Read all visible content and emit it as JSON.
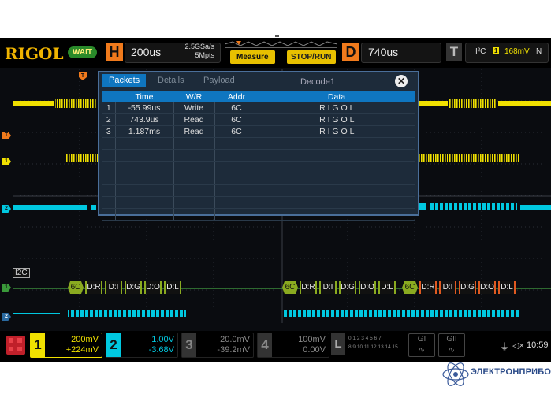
{
  "brand": "RIGOL",
  "run_state": "WAIT",
  "horizontal": {
    "key": "H",
    "timebase": "200us",
    "sample_rate": "2.5GSa/s",
    "memory_depth": "5Mpts"
  },
  "buttons": {
    "measure": "Measure",
    "stop_run": "STOP/RUN"
  },
  "delay": {
    "key": "D",
    "value": "740us"
  },
  "trigger": {
    "key": "T",
    "source": "I²C",
    "channel": "1",
    "level": "168mV",
    "mode": "N"
  },
  "markers": {
    "trigger_pos": "T",
    "ch1": "1",
    "ch2": "2",
    "bus": "I2C"
  },
  "bus_frames": [
    {
      "addr": "6C",
      "bytes": [
        "D:R",
        "D:I",
        "D:G",
        "D:O",
        "D:L"
      ]
    },
    {
      "addr": "6C",
      "bytes": [
        "D:R",
        "D:I",
        "D:G",
        "D:O",
        "D:L"
      ]
    },
    {
      "addr": "6C",
      "bytes": [
        "D:R",
        "D:I",
        "D:G",
        "D:O",
        "D:L"
      ]
    }
  ],
  "dialog": {
    "tabs": [
      "Packets",
      "Details",
      "Payload"
    ],
    "title": "Decode1",
    "columns": [
      "",
      "Time",
      "W/R",
      "Addr",
      "Data"
    ],
    "rows": [
      [
        "1",
        "-55.99us",
        "Write",
        "6C",
        "R I G O L"
      ],
      [
        "2",
        "743.9us",
        "Read",
        "6C",
        "R I G O L"
      ],
      [
        "3",
        "1.187ms",
        "Read",
        "6C",
        "R I G O L"
      ]
    ]
  },
  "channels": [
    {
      "num": "1",
      "scale": "200mV",
      "offset": "+224mV",
      "color": "#f0e000"
    },
    {
      "num": "2",
      "scale": "1.00V",
      "offset": "-3.68V",
      "color": "#00c8e0"
    },
    {
      "num": "3",
      "scale": "20.0mV",
      "offset": "-39.2mV",
      "color": "#777777"
    },
    {
      "num": "4",
      "scale": "100mV",
      "offset": "0.00V",
      "color": "#777777"
    }
  ],
  "logic": {
    "key": "L",
    "row1": "0 1 2 3 4 5 6 7",
    "row2": "8 9 10 11 12 13 14 15"
  },
  "gen_buttons": [
    "GI",
    "GII"
  ],
  "status": {
    "clock": "10:59"
  },
  "watermark": "ЭЛЕКТРОНПРИБОР",
  "colors": {
    "ch1": "#f0e000",
    "ch2": "#00c8e0",
    "accent": "#f07a1c",
    "bus_addr": "#8aaa20"
  }
}
